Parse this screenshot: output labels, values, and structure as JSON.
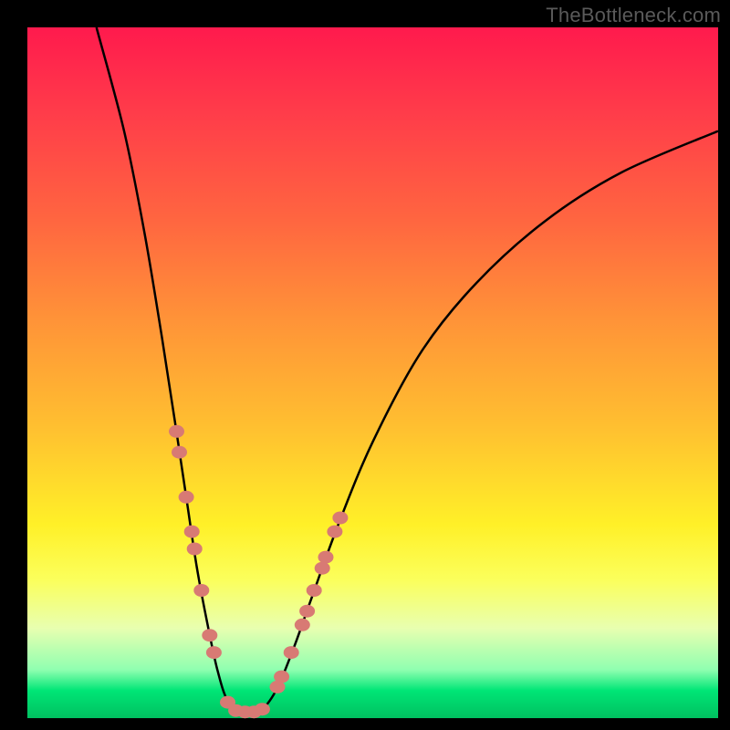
{
  "watermark": "TheBottleneck.com",
  "chart_data": {
    "type": "line",
    "title": "",
    "xlabel": "",
    "ylabel": "",
    "xlim": [
      0,
      100
    ],
    "ylim": [
      0,
      100
    ],
    "grid": false,
    "series": [
      {
        "name": "curve",
        "points": [
          {
            "x": 10.0,
            "y": 100.0
          },
          {
            "x": 14.0,
            "y": 85.0
          },
          {
            "x": 17.0,
            "y": 70.0
          },
          {
            "x": 19.5,
            "y": 55.0
          },
          {
            "x": 21.5,
            "y": 42.0
          },
          {
            "x": 23.0,
            "y": 32.0
          },
          {
            "x": 24.5,
            "y": 22.0
          },
          {
            "x": 26.0,
            "y": 14.0
          },
          {
            "x": 27.5,
            "y": 7.0
          },
          {
            "x": 29.0,
            "y": 2.5
          },
          {
            "x": 31.0,
            "y": 0.9
          },
          {
            "x": 33.5,
            "y": 0.9
          },
          {
            "x": 36.0,
            "y": 4.0
          },
          {
            "x": 38.5,
            "y": 10.0
          },
          {
            "x": 41.0,
            "y": 17.0
          },
          {
            "x": 45.0,
            "y": 28.0
          },
          {
            "x": 50.0,
            "y": 40.0
          },
          {
            "x": 57.0,
            "y": 53.0
          },
          {
            "x": 65.0,
            "y": 63.0
          },
          {
            "x": 75.0,
            "y": 72.0
          },
          {
            "x": 86.0,
            "y": 79.0
          },
          {
            "x": 100.0,
            "y": 85.0
          }
        ]
      }
    ],
    "markers": [
      {
        "x": 21.6,
        "y": 41.5
      },
      {
        "x": 22.0,
        "y": 38.5
      },
      {
        "x": 23.0,
        "y": 32.0
      },
      {
        "x": 23.8,
        "y": 27.0
      },
      {
        "x": 24.2,
        "y": 24.5
      },
      {
        "x": 25.2,
        "y": 18.5
      },
      {
        "x": 26.4,
        "y": 12.0
      },
      {
        "x": 27.0,
        "y": 9.5
      },
      {
        "x": 29.0,
        "y": 2.3
      },
      {
        "x": 30.2,
        "y": 1.1
      },
      {
        "x": 31.5,
        "y": 0.9
      },
      {
        "x": 32.8,
        "y": 0.9
      },
      {
        "x": 34.0,
        "y": 1.3
      },
      {
        "x": 36.2,
        "y": 4.5
      },
      {
        "x": 36.8,
        "y": 6.0
      },
      {
        "x": 38.2,
        "y": 9.5
      },
      {
        "x": 39.8,
        "y": 13.5
      },
      {
        "x": 40.5,
        "y": 15.5
      },
      {
        "x": 41.5,
        "y": 18.5
      },
      {
        "x": 42.7,
        "y": 21.7
      },
      {
        "x": 43.2,
        "y": 23.3
      },
      {
        "x": 44.5,
        "y": 27.0
      },
      {
        "x": 45.3,
        "y": 29.0
      }
    ],
    "marker_color": "#d87a74",
    "gradient_stops": [
      {
        "pos": 0.0,
        "color": "#ff1a4d"
      },
      {
        "pos": 0.72,
        "color": "#fff028"
      },
      {
        "pos": 1.0,
        "color": "#00c060"
      }
    ]
  }
}
